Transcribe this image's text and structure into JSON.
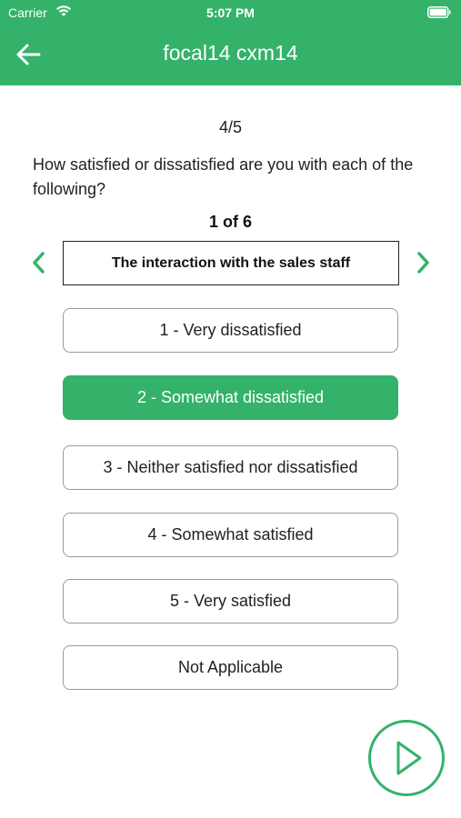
{
  "status_bar": {
    "carrier": "Carrier",
    "time": "5:07 PM"
  },
  "header": {
    "title": "focal14 cxm14",
    "background_color": "#34b26a"
  },
  "survey": {
    "progress": "4/5",
    "question": "How satisfied or dissatisfied are you with each of the following?",
    "item_counter": "1 of 6",
    "current_item": "The interaction with the sales staff",
    "options": [
      {
        "label": "1 - Very dissatisfied",
        "selected": false
      },
      {
        "label": "2 - Somewhat dissatisfied",
        "selected": true
      },
      {
        "label": "3 - Neither satisfied nor dissatisfied",
        "selected": false
      },
      {
        "label": "4 - Somewhat satisfied",
        "selected": false
      },
      {
        "label": "5 - Very satisfied",
        "selected": false
      },
      {
        "label": "Not Applicable",
        "selected": false
      }
    ]
  },
  "icons": {
    "back": "arrow-left-icon",
    "prev": "chevron-left-icon",
    "next": "chevron-right-icon",
    "submit": "play-icon"
  },
  "accent_color": "#34b26a"
}
